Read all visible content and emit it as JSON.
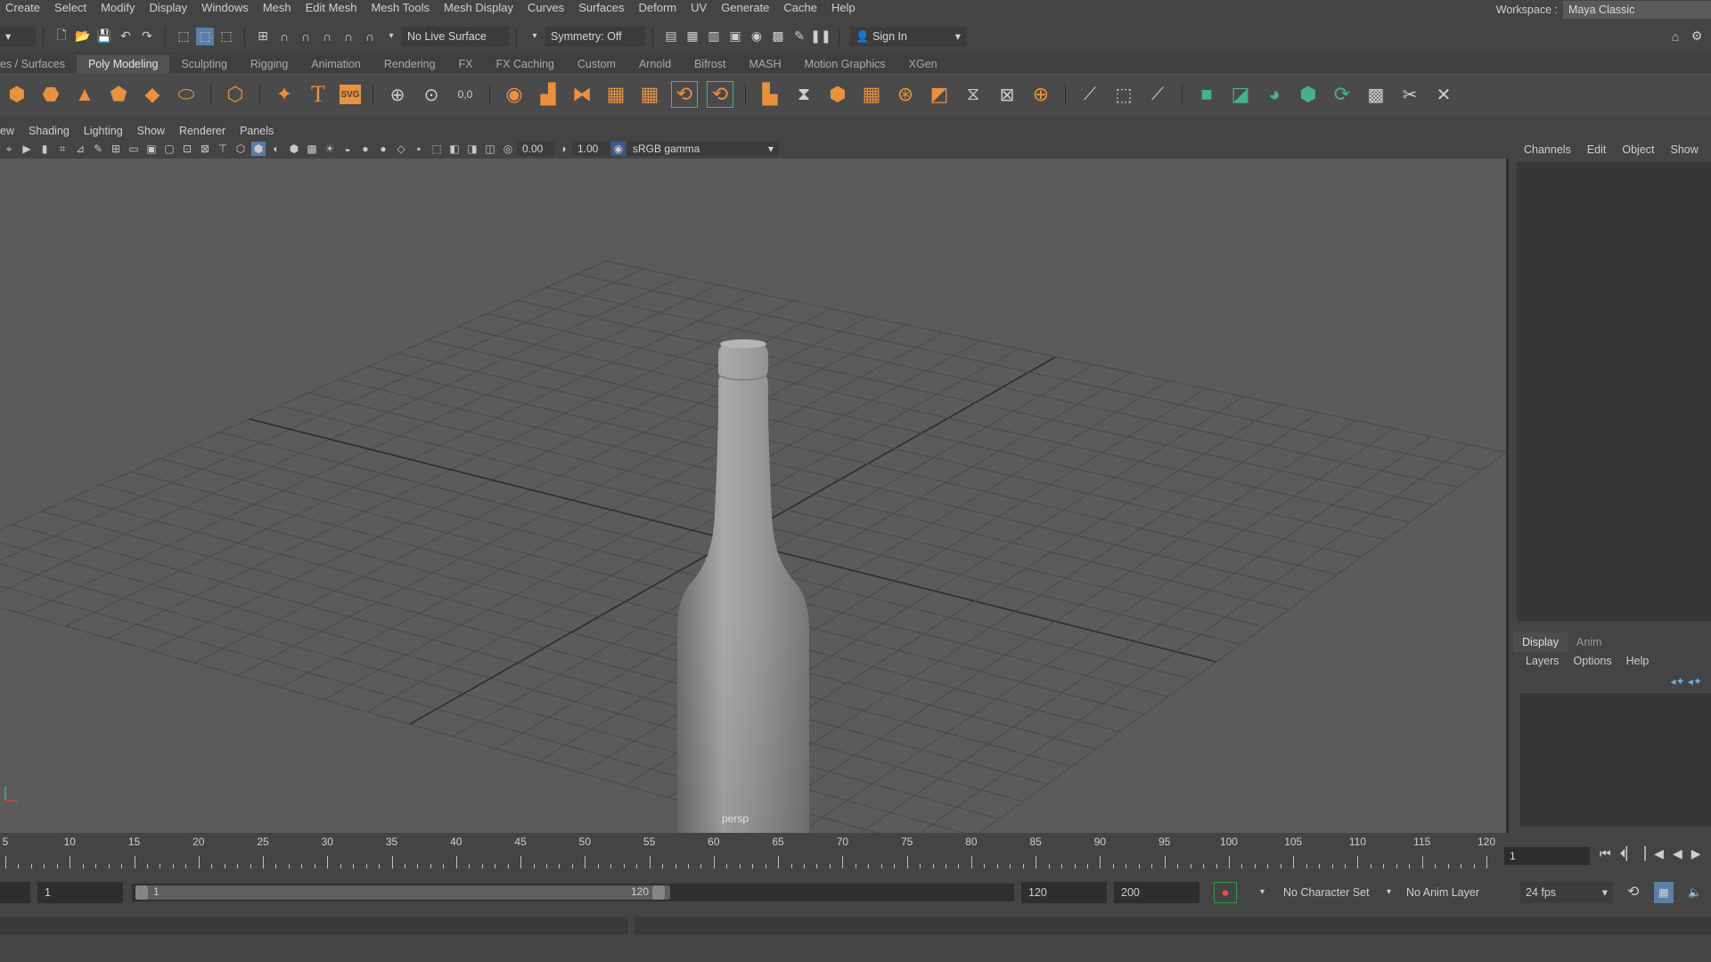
{
  "menubar": {
    "items": [
      "Create",
      "Select",
      "Modify",
      "Display",
      "Windows",
      "Mesh",
      "Edit Mesh",
      "Mesh Tools",
      "Mesh Display",
      "Curves",
      "Surfaces",
      "Deform",
      "UV",
      "Generate",
      "Cache",
      "Help"
    ],
    "workspace_label": "Workspace :",
    "workspace_value": "Maya Classic"
  },
  "statusline": {
    "live_surface": "No Live Surface",
    "symmetry": "Symmetry: Off",
    "sign_in": "Sign In"
  },
  "shelf_tabs": {
    "items": [
      "es / Surfaces",
      "Poly Modeling",
      "Sculpting",
      "Rigging",
      "Animation",
      "Rendering",
      "FX",
      "FX Caching",
      "Custom",
      "Arnold",
      "Bifrost",
      "MASH",
      "Motion Graphics",
      "XGen"
    ],
    "active": "Poly Modeling"
  },
  "viewport": {
    "menu": [
      "ew",
      "Shading",
      "Lighting",
      "Show",
      "Renderer",
      "Panels"
    ],
    "exposure": "0.00",
    "gamma": "1.00",
    "color_space": "sRGB gamma",
    "camera": "persp"
  },
  "channel_box": {
    "menu": [
      "Channels",
      "Edit",
      "Object",
      "Show"
    ]
  },
  "layer_editor": {
    "tabs": [
      "Display",
      "Anim"
    ],
    "active_tab": "Display",
    "menu": [
      "Layers",
      "Options",
      "Help"
    ]
  },
  "time_slider": {
    "ticks": [
      "5",
      "10",
      "15",
      "20",
      "25",
      "30",
      "35",
      "40",
      "45",
      "50",
      "55",
      "60",
      "65",
      "70",
      "75",
      "80",
      "85",
      "90",
      "95",
      "100",
      "105",
      "110",
      "115",
      "120"
    ],
    "current_frame": "1"
  },
  "range_slider": {
    "start_time": "1",
    "range_start": "1",
    "range_end": "120",
    "end_time": "120",
    "max_time": "200",
    "character_set": "No Character Set",
    "anim_layer": "No Anim Layer",
    "fps": "24 fps"
  },
  "colors": {
    "accent_orange": "#e8913e",
    "accent_green": "#46b28a",
    "viewport_bg": "#5b5b5b"
  }
}
